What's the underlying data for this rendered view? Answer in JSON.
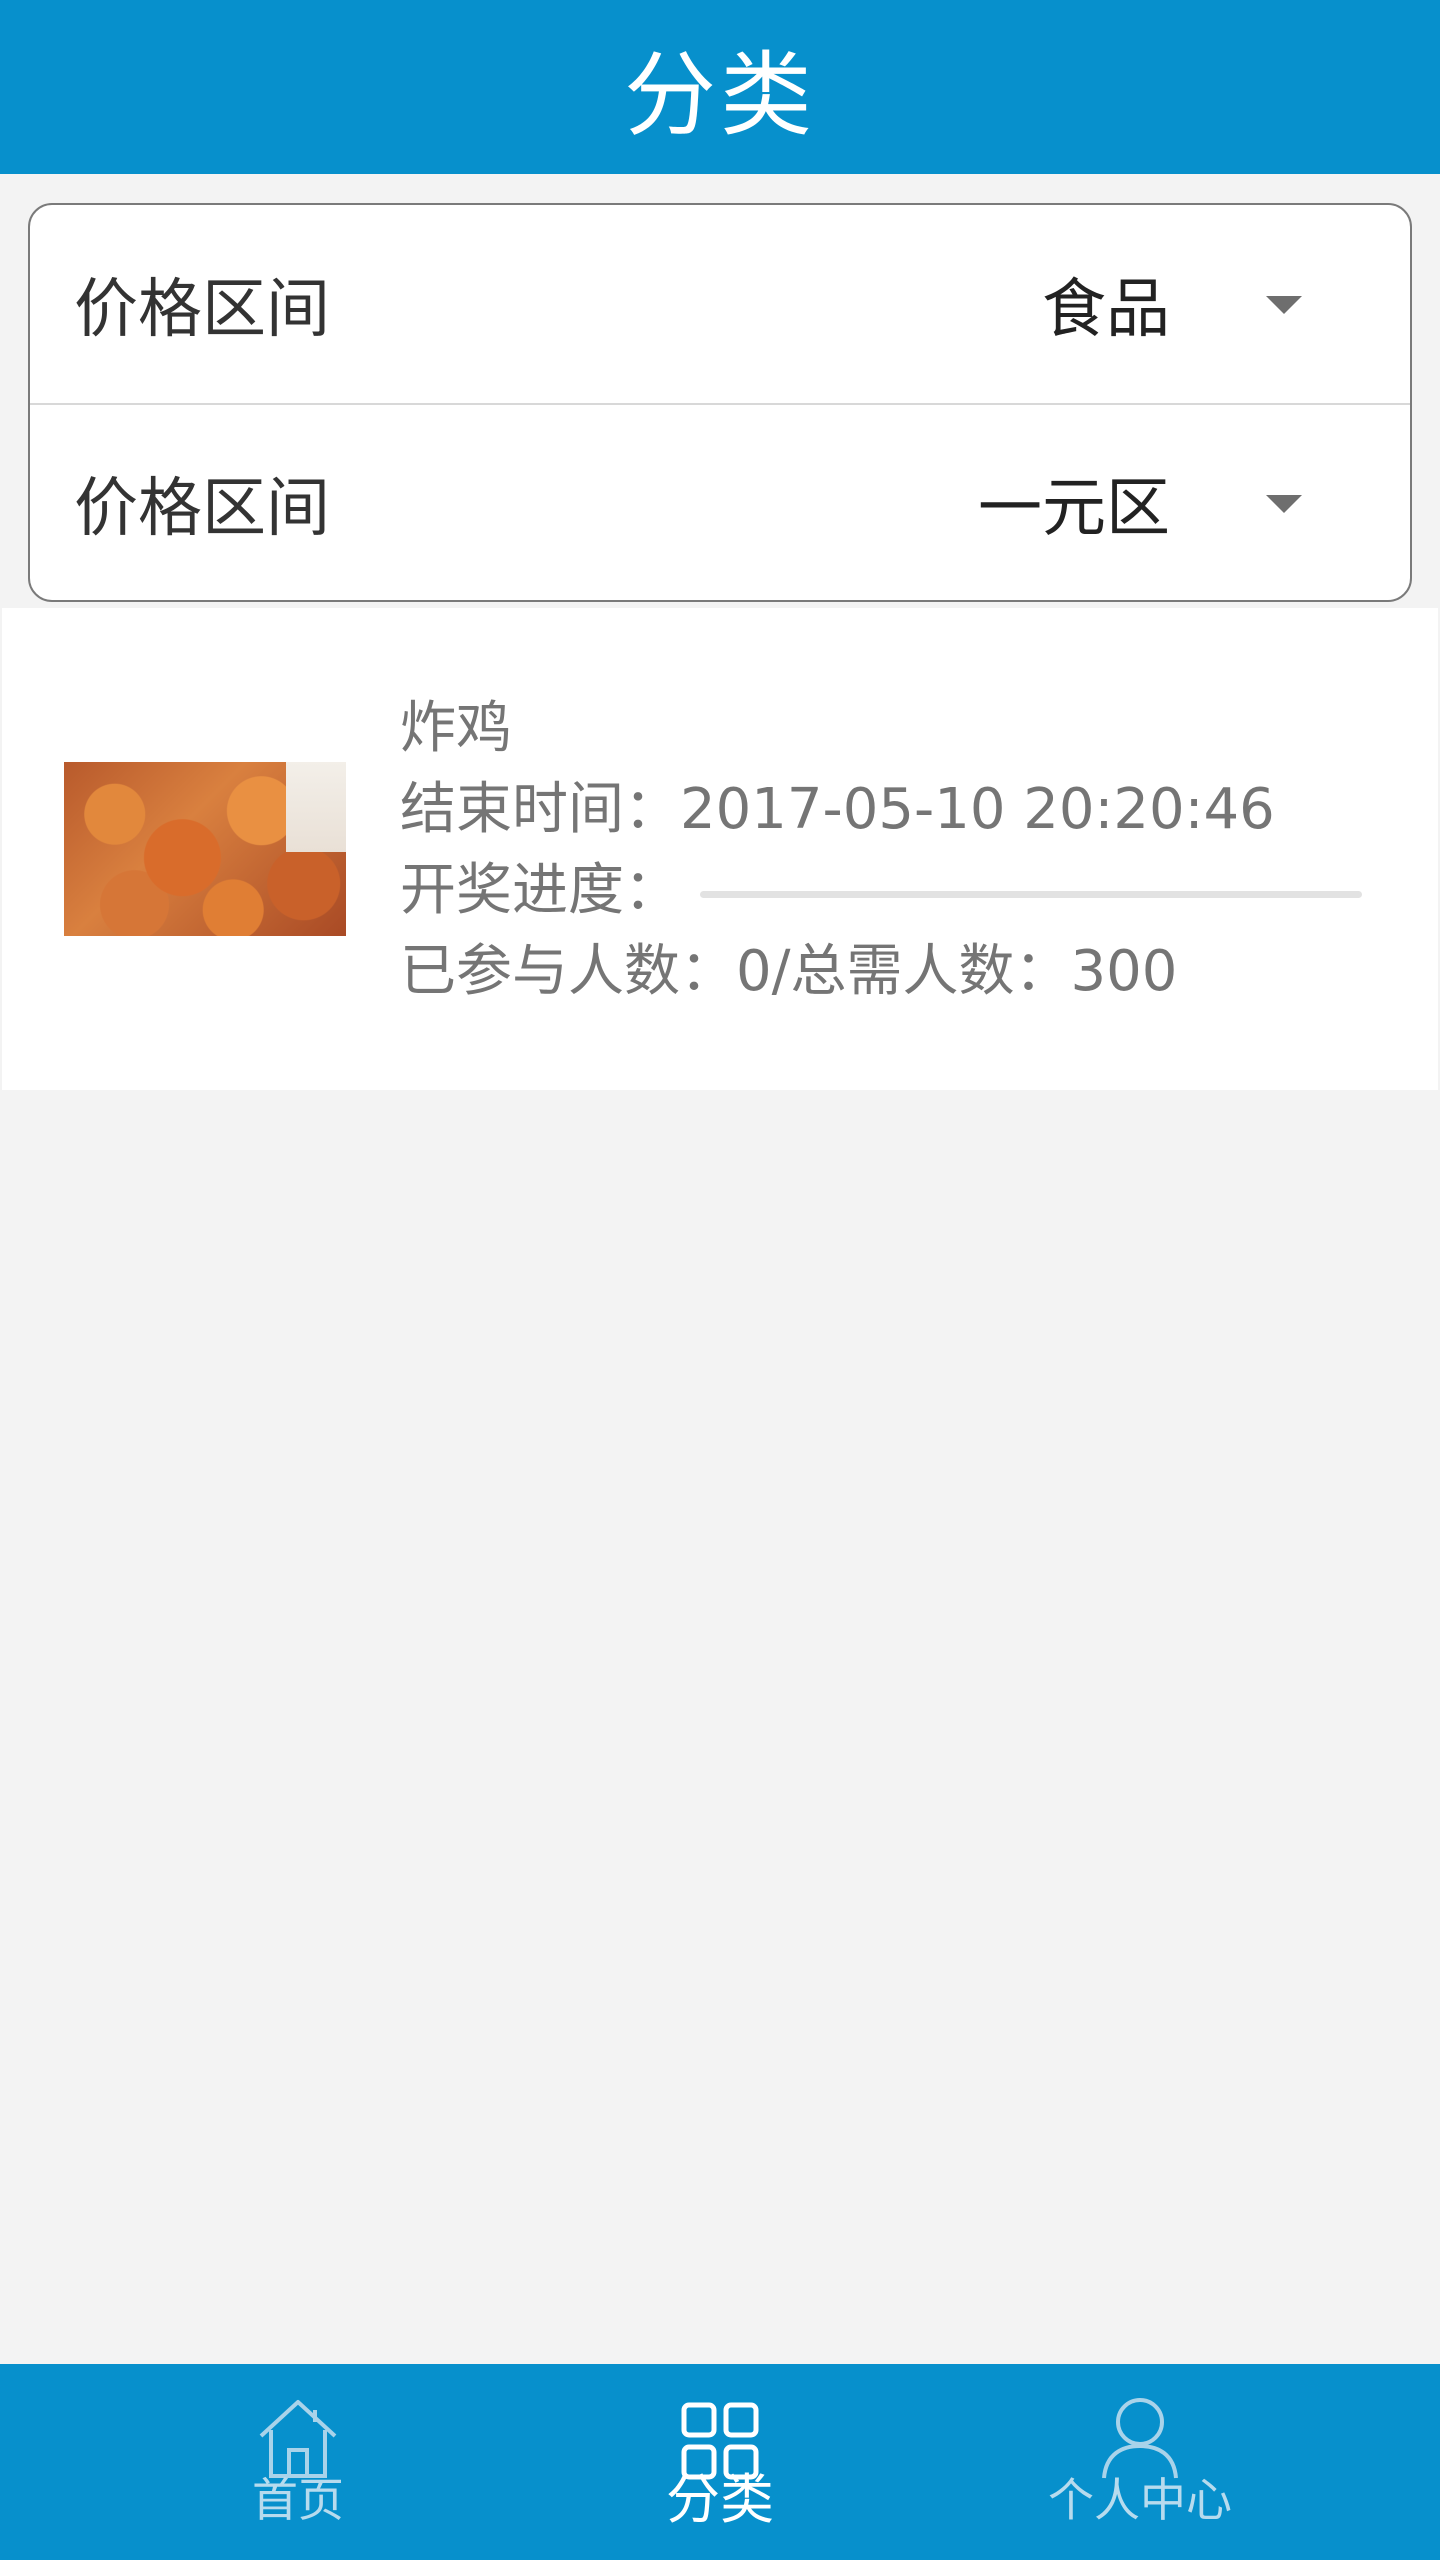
{
  "header": {
    "title": "分类"
  },
  "filters": [
    {
      "label": "价格区间",
      "value": "食品"
    },
    {
      "label": "价格区间",
      "value": "一元区"
    }
  ],
  "product": {
    "name": "炸鸡",
    "end_time_label": "结束时间：",
    "end_time": "2017-05-10 20:20:46",
    "progress_label": "开奖进度：",
    "progress": 0,
    "participants_label": "已参与人数：",
    "participants": "0",
    "separator": "/",
    "total_label": "总需人数：",
    "total": "300"
  },
  "tabbar": {
    "items": [
      {
        "label": "首页",
        "icon": "home-icon",
        "active": false
      },
      {
        "label": "分类",
        "icon": "grid-icon",
        "active": true
      },
      {
        "label": "个人中心",
        "icon": "person-icon",
        "active": false
      }
    ]
  },
  "colors": {
    "brand_blue": "#0790cc",
    "background": "#f3f3f3",
    "text_muted": "#757575"
  }
}
